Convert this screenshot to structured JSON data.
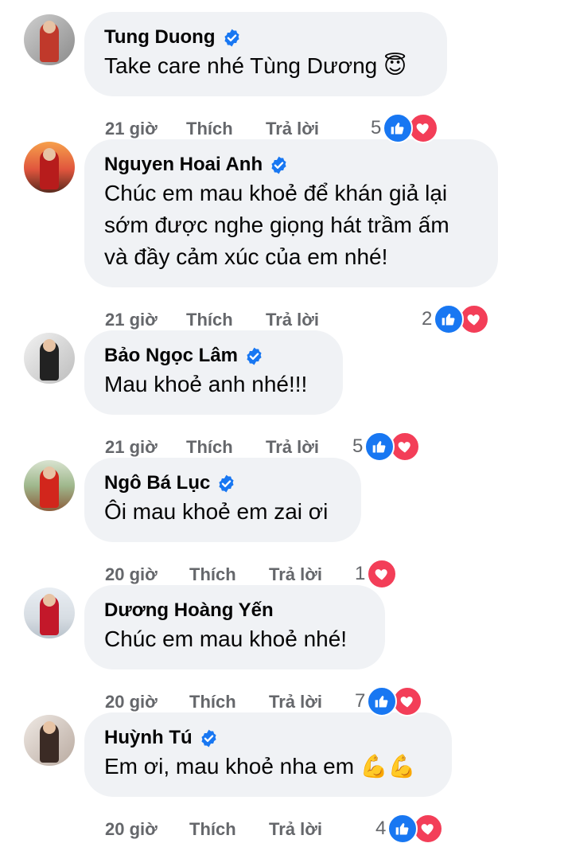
{
  "colors": {
    "bubble": "#f0f2f5",
    "meta": "#65676b",
    "like": "#1877f2",
    "love": "#f33e58",
    "verified": "#1877f2"
  },
  "comments": [
    {
      "name": "Tung Duong",
      "verified": true,
      "text": [
        "Take care nhé Tùng Dương 😇"
      ],
      "time": "21 giờ",
      "like": "Thích",
      "reply": "Trả lời",
      "count": "5",
      "reactions": [
        "like",
        "love"
      ],
      "avatar": "avatar-red-suit"
    },
    {
      "name": "Nguyen Hoai Anh",
      "verified": true,
      "text": [
        "Chúc em mau khoẻ để khán giả lại",
        "sớm được nghe giọng hát trầm ấm",
        "và đầy cảm xúc của em nhé!"
      ],
      "time": "21 giờ",
      "like": "Thích",
      "reply": "Trả lời",
      "count": "2",
      "reactions": [
        "like",
        "love"
      ],
      "avatar": "avatar-sunset-poster"
    },
    {
      "name": "Bảo Ngọc Lâm",
      "verified": true,
      "text": [
        "Mau khoẻ anh nhé!!!"
      ],
      "time": "21 giờ",
      "like": "Thích",
      "reply": "Trả lời",
      "count": "5",
      "reactions": [
        "like",
        "love"
      ],
      "avatar": "avatar-woman-bw"
    },
    {
      "name": "Ngô Bá Lục",
      "verified": true,
      "text": [
        "Ôi mau khoẻ em zai ơi"
      ],
      "time": "20 giờ",
      "like": "Thích",
      "reply": "Trả lời",
      "count": "1",
      "reactions": [
        "love"
      ],
      "avatar": "avatar-boat-landscape"
    },
    {
      "name": "Dương Hoàng Yến",
      "verified": false,
      "text": [
        "Chúc em mau khoẻ nhé!"
      ],
      "time": "20 giờ",
      "like": "Thích",
      "reply": "Trả lời",
      "count": "7",
      "reactions": [
        "like",
        "love"
      ],
      "avatar": "avatar-red-dress"
    },
    {
      "name": "Huỳnh Tú",
      "verified": true,
      "text": [
        "Em ơi, mau khoẻ nha em 💪💪"
      ],
      "time": "20 giờ",
      "like": "Thích",
      "reply": "Trả lời",
      "count": "4",
      "reactions": [
        "like",
        "love"
      ],
      "avatar": "avatar-woman-portrait"
    }
  ]
}
